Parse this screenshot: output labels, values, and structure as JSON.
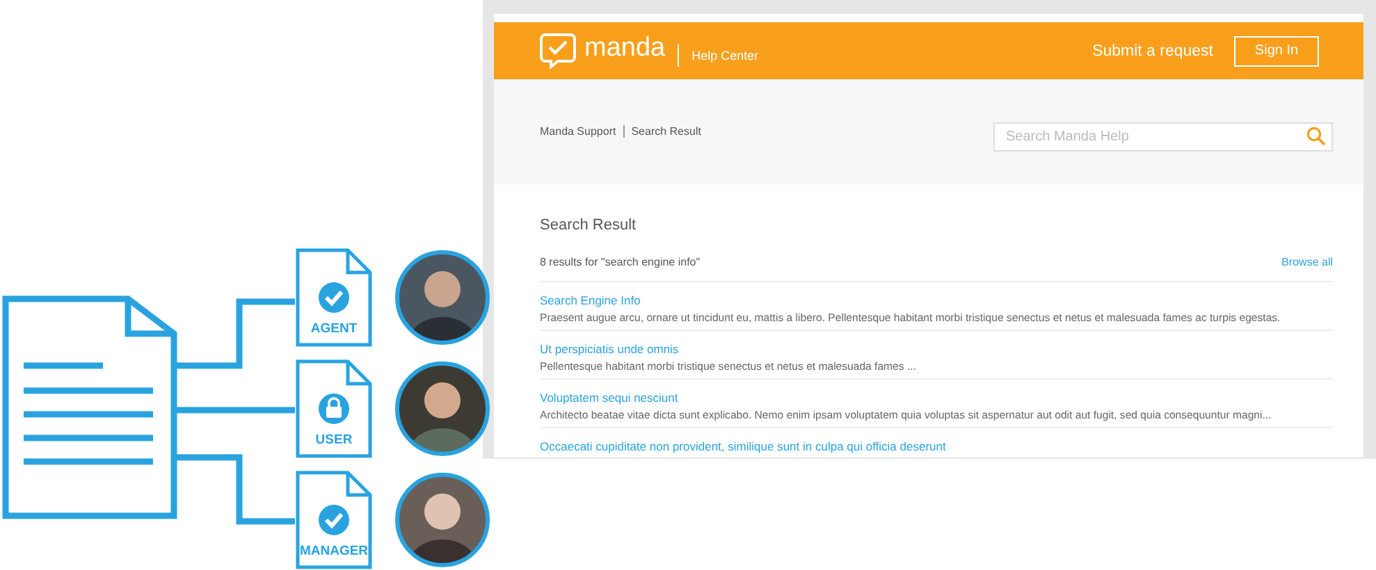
{
  "diagram": {
    "roles": [
      {
        "label": "AGENT",
        "kind": "check"
      },
      {
        "label": "USER",
        "kind": "lock"
      },
      {
        "label": "MANAGER",
        "kind": "check"
      }
    ]
  },
  "help_center": {
    "brand": "manda",
    "section": "Help Center",
    "nav_link": "Submit a request",
    "sign_in": "Sign In",
    "breadcrumb": [
      "Manda Support",
      "Search Result"
    ],
    "search": {
      "placeholder": "Search Manda Help"
    },
    "heading": "Search Result",
    "summary": "8 results for \"search engine info\"",
    "browse_all": "Browse all",
    "results": [
      {
        "title": "Search Engine Info",
        "snippet": "Praesent augue arcu, ornare ut tincidunt eu, mattis a libero. Pellentesque habitant morbi tristique senectus et netus et malesuada fames ac turpis egestas."
      },
      {
        "title": "Ut perspiciatis unde omnis",
        "snippet": "Pellentesque habitant morbi tristique senectus et netus et malesuada fames ..."
      },
      {
        "title": "Voluptatem sequi nesciunt",
        "snippet": "Architecto beatae vitae dicta sunt explicabo. Nemo enim ipsam voluptatem quia voluptas sit aspernatur aut odit aut fugit, sed quia consequuntur magni..."
      },
      {
        "title": "Occaecati cupiditate non provident, similique sunt in culpa qui officia deserunt"
      }
    ]
  }
}
